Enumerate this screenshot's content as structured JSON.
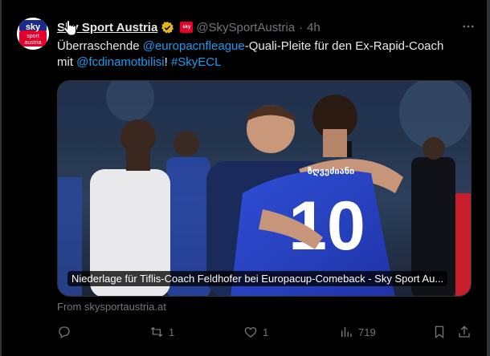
{
  "tweet": {
    "author_name": "Sky Sport Austria",
    "handle": "@SkySportAustria",
    "separator": "·",
    "time": "4h",
    "avatar_brand": "sky",
    "avatar_sub1": "sport",
    "avatar_sub2": "austria",
    "affiliate_badge": "sky",
    "text_parts": {
      "p1": "Überraschende ",
      "mention1": "@europacnfleague",
      "p2": "-Quali-Pleite für den Ex-Rapid-Coach",
      "p3": "mit ",
      "mention2": "@fcdinamotbilisi",
      "p4": "! ",
      "hashtag": "#SkyECL"
    },
    "card": {
      "title": "Niederlage für Tiflis-Coach Feldhofer bei Europacup-Comeback - Sky Sport Au...",
      "jersey_number": "10",
      "jersey_name": "ზღვეძიანი"
    },
    "source": "From skysportaustria.at",
    "actions": {
      "reply_count": "",
      "retweet_count": "1",
      "like_count": "1",
      "views_count": "719"
    }
  },
  "icons": [
    "verified-icon",
    "more-icon",
    "reply-icon",
    "retweet-icon",
    "like-icon",
    "views-icon",
    "bookmark-icon",
    "share-icon",
    "hand-cursor-icon"
  ],
  "colors": {
    "link": "#1d9bf0",
    "muted": "#71767b",
    "verified": "#e2b719",
    "sky_red": "#e4002b"
  }
}
